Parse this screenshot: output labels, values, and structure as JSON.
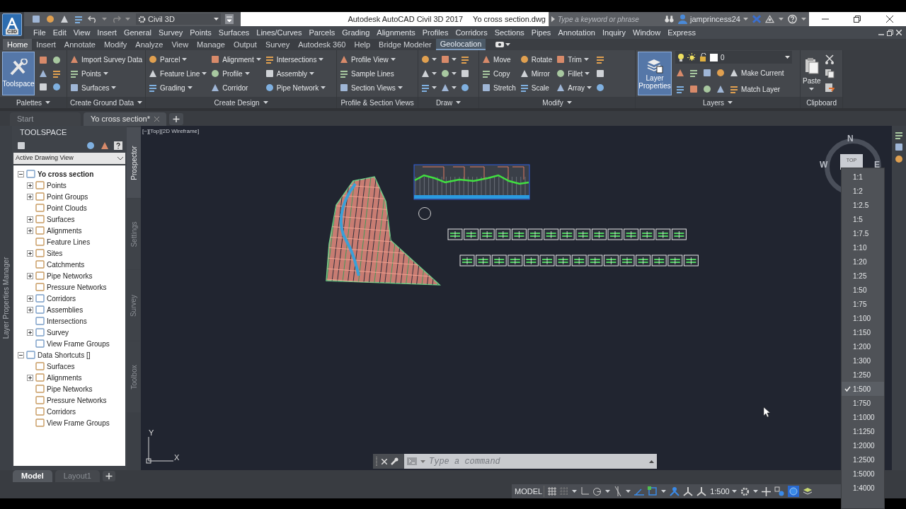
{
  "window": {
    "app_badge": "C3D",
    "workspace": "Civil 3D",
    "title": "Autodesk AutoCAD Civil 3D 2017",
    "document": "Yo cross section.dwg",
    "search_placeholder": "Type a keyword or phrase",
    "user": "jamprincess24"
  },
  "menu": [
    "File",
    "Edit",
    "View",
    "Insert",
    "General",
    "Survey",
    "Points",
    "Surfaces",
    "Lines/Curves",
    "Parcels",
    "Grading",
    "Alignments",
    "Profiles",
    "Corridors",
    "Sections",
    "Pipes",
    "Annotation",
    "Inquiry",
    "Window",
    "Express"
  ],
  "ribbon_tabs": [
    {
      "label": "Home",
      "selected": true,
      "contextual": false
    },
    {
      "label": "Insert",
      "selected": false,
      "contextual": false
    },
    {
      "label": "Annotate",
      "selected": false,
      "contextual": false
    },
    {
      "label": "Modify",
      "selected": false,
      "contextual": false
    },
    {
      "label": "Analyze",
      "selected": false,
      "contextual": false
    },
    {
      "label": "View",
      "selected": false,
      "contextual": false
    },
    {
      "label": "Manage",
      "selected": false,
      "contextual": false
    },
    {
      "label": "Output",
      "selected": false,
      "contextual": false
    },
    {
      "label": "Survey",
      "selected": false,
      "contextual": false
    },
    {
      "label": "Autodesk 360",
      "selected": false,
      "contextual": false
    },
    {
      "label": "Help",
      "selected": false,
      "contextual": false
    },
    {
      "label": "Bridge Modeler",
      "selected": false,
      "contextual": false
    },
    {
      "label": "Geolocation",
      "selected": false,
      "contextual": true
    }
  ],
  "ribbon_panels": [
    {
      "kind": "palettes",
      "title": "Palettes",
      "title_dropdown": true,
      "big_button": "Toolspace"
    },
    {
      "kind": "list",
      "title": "Create Ground Data",
      "title_dropdown": true,
      "columns": [
        [
          {
            "label": "Import Survey Data",
            "dropdown": false
          },
          {
            "label": "Points",
            "dropdown": true
          },
          {
            "label": "Surfaces",
            "dropdown": true
          }
        ]
      ]
    },
    {
      "kind": "list",
      "title": "Create Design",
      "title_dropdown": true,
      "columns": [
        [
          {
            "label": "Parcel",
            "dropdown": true
          },
          {
            "label": "Feature Line",
            "dropdown": true
          },
          {
            "label": "Grading",
            "dropdown": true
          }
        ],
        [
          {
            "label": "Alignment",
            "dropdown": true
          },
          {
            "label": "Profile",
            "dropdown": true
          },
          {
            "label": "Corridor",
            "dropdown": false
          }
        ],
        [
          {
            "label": "Intersections",
            "dropdown": true
          },
          {
            "label": "Assembly",
            "dropdown": true
          },
          {
            "label": "Pipe Network",
            "dropdown": true
          }
        ]
      ]
    },
    {
      "kind": "list",
      "title": "Profile & Section Views",
      "title_dropdown": false,
      "columns": [
        [
          {
            "label": "Profile View",
            "dropdown": true
          },
          {
            "label": "Sample Lines",
            "dropdown": false
          },
          {
            "label": "Section Views",
            "dropdown": true
          }
        ]
      ]
    },
    {
      "kind": "draw",
      "title": "Draw",
      "title_dropdown": true
    },
    {
      "kind": "list",
      "title": "Modify",
      "title_dropdown": true,
      "columns": [
        [
          {
            "label": "Move",
            "dropdown": false
          },
          {
            "label": "Copy",
            "dropdown": false
          },
          {
            "label": "Stretch",
            "dropdown": false
          }
        ],
        [
          {
            "label": "Rotate",
            "dropdown": false
          },
          {
            "label": "Mirror",
            "dropdown": false
          },
          {
            "label": "Scale",
            "dropdown": false
          }
        ],
        [
          {
            "label": "Trim",
            "dropdown": true
          },
          {
            "label": "Fillet",
            "dropdown": true
          },
          {
            "label": "Array",
            "dropdown": true
          }
        ]
      ]
    },
    {
      "kind": "layers",
      "title": "Layers",
      "title_dropdown": true,
      "big_button": "Layer Properties",
      "current_layer": "0",
      "columns": [
        [
          {
            "label": "Make Current",
            "dropdown": false
          },
          {
            "label": "Match Layer",
            "dropdown": false
          }
        ]
      ]
    },
    {
      "kind": "clipboard",
      "title": "Clipboard",
      "title_dropdown": false,
      "big_button": "Paste"
    }
  ],
  "doc_tabs": [
    {
      "label": "Start",
      "selected": false
    },
    {
      "label": "Yo cross section*",
      "selected": true
    }
  ],
  "side_strip": "Layer Properties Manager",
  "toolspace": {
    "title": "TOOLSPACE",
    "view": "Active Drawing View",
    "tree": [
      {
        "label": "Yo cross section",
        "active": true,
        "expandable": true,
        "expanded": true,
        "children": [
          {
            "label": "Points",
            "expandable": true,
            "expanded": false
          },
          {
            "label": "Point Groups",
            "expandable": true,
            "expanded": false
          },
          {
            "label": "Point Clouds",
            "expandable": false
          },
          {
            "label": "Surfaces",
            "expandable": true,
            "expanded": false
          },
          {
            "label": "Alignments",
            "expandable": true,
            "expanded": false
          },
          {
            "label": "Feature Lines",
            "expandable": false
          },
          {
            "label": "Sites",
            "expandable": true,
            "expanded": false
          },
          {
            "label": "Catchments",
            "expandable": false
          },
          {
            "label": "Pipe Networks",
            "expandable": true,
            "expanded": false
          },
          {
            "label": "Pressure Networks",
            "expandable": false
          },
          {
            "label": "Corridors",
            "expandable": true,
            "expanded": false
          },
          {
            "label": "Assemblies",
            "expandable": true,
            "expanded": false
          },
          {
            "label": "Intersections",
            "expandable": false
          },
          {
            "label": "Survey",
            "expandable": true,
            "expanded": false
          },
          {
            "label": "View Frame Groups",
            "expandable": false
          }
        ]
      },
      {
        "label": "Data Shortcuts []",
        "active": false,
        "expandable": true,
        "expanded": true,
        "children": [
          {
            "label": "Surfaces",
            "expandable": false
          },
          {
            "label": "Alignments",
            "expandable": true,
            "expanded": false
          },
          {
            "label": "Pipe Networks",
            "expandable": false
          },
          {
            "label": "Pressure Networks",
            "expandable": false
          },
          {
            "label": "Corridors",
            "expandable": false
          },
          {
            "label": "View Frame Groups",
            "expandable": false
          }
        ]
      }
    ],
    "side_tabs": [
      {
        "label": "Prospector",
        "selected": true
      },
      {
        "label": "Settings",
        "selected": false
      },
      {
        "label": "Survey",
        "selected": false
      },
      {
        "label": "Toolbox",
        "selected": false
      }
    ]
  },
  "viewport": {
    "label": "[−][Top][2D Wireframe]",
    "viewcube": {
      "north": "N",
      "west": "W",
      "east": "E",
      "face": "TOP"
    },
    "ucs": {
      "x": "X",
      "y": "Y"
    }
  },
  "command_line": {
    "placeholder": "Type a command"
  },
  "layout_tabs": [
    {
      "label": "Model",
      "selected": true
    },
    {
      "label": "Layout1",
      "selected": false
    }
  ],
  "status_bar": {
    "space": "MODEL",
    "annotation_scale": "1:500"
  },
  "scale_menu": [
    {
      "label": "1:1",
      "selected": false
    },
    {
      "label": "1:2",
      "selected": false
    },
    {
      "label": "1:2.5",
      "selected": false
    },
    {
      "label": "1:5",
      "selected": false
    },
    {
      "label": "1:7.5",
      "selected": false
    },
    {
      "label": "1:10",
      "selected": false
    },
    {
      "label": "1:20",
      "selected": false
    },
    {
      "label": "1:25",
      "selected": false
    },
    {
      "label": "1:50",
      "selected": false
    },
    {
      "label": "1:75",
      "selected": false
    },
    {
      "label": "1:100",
      "selected": false
    },
    {
      "label": "1:150",
      "selected": false
    },
    {
      "label": "1:200",
      "selected": false
    },
    {
      "label": "1:300",
      "selected": false
    },
    {
      "label": "1:250",
      "selected": false
    },
    {
      "label": "1:500",
      "selected": true
    },
    {
      "label": "1:750",
      "selected": false
    },
    {
      "label": "1:1000",
      "selected": false
    },
    {
      "label": "1:1250",
      "selected": false
    },
    {
      "label": "1:2000",
      "selected": false
    },
    {
      "label": "1:2500",
      "selected": false
    },
    {
      "label": "1:5000",
      "selected": false
    },
    {
      "label": "1:4000",
      "selected": false
    }
  ]
}
